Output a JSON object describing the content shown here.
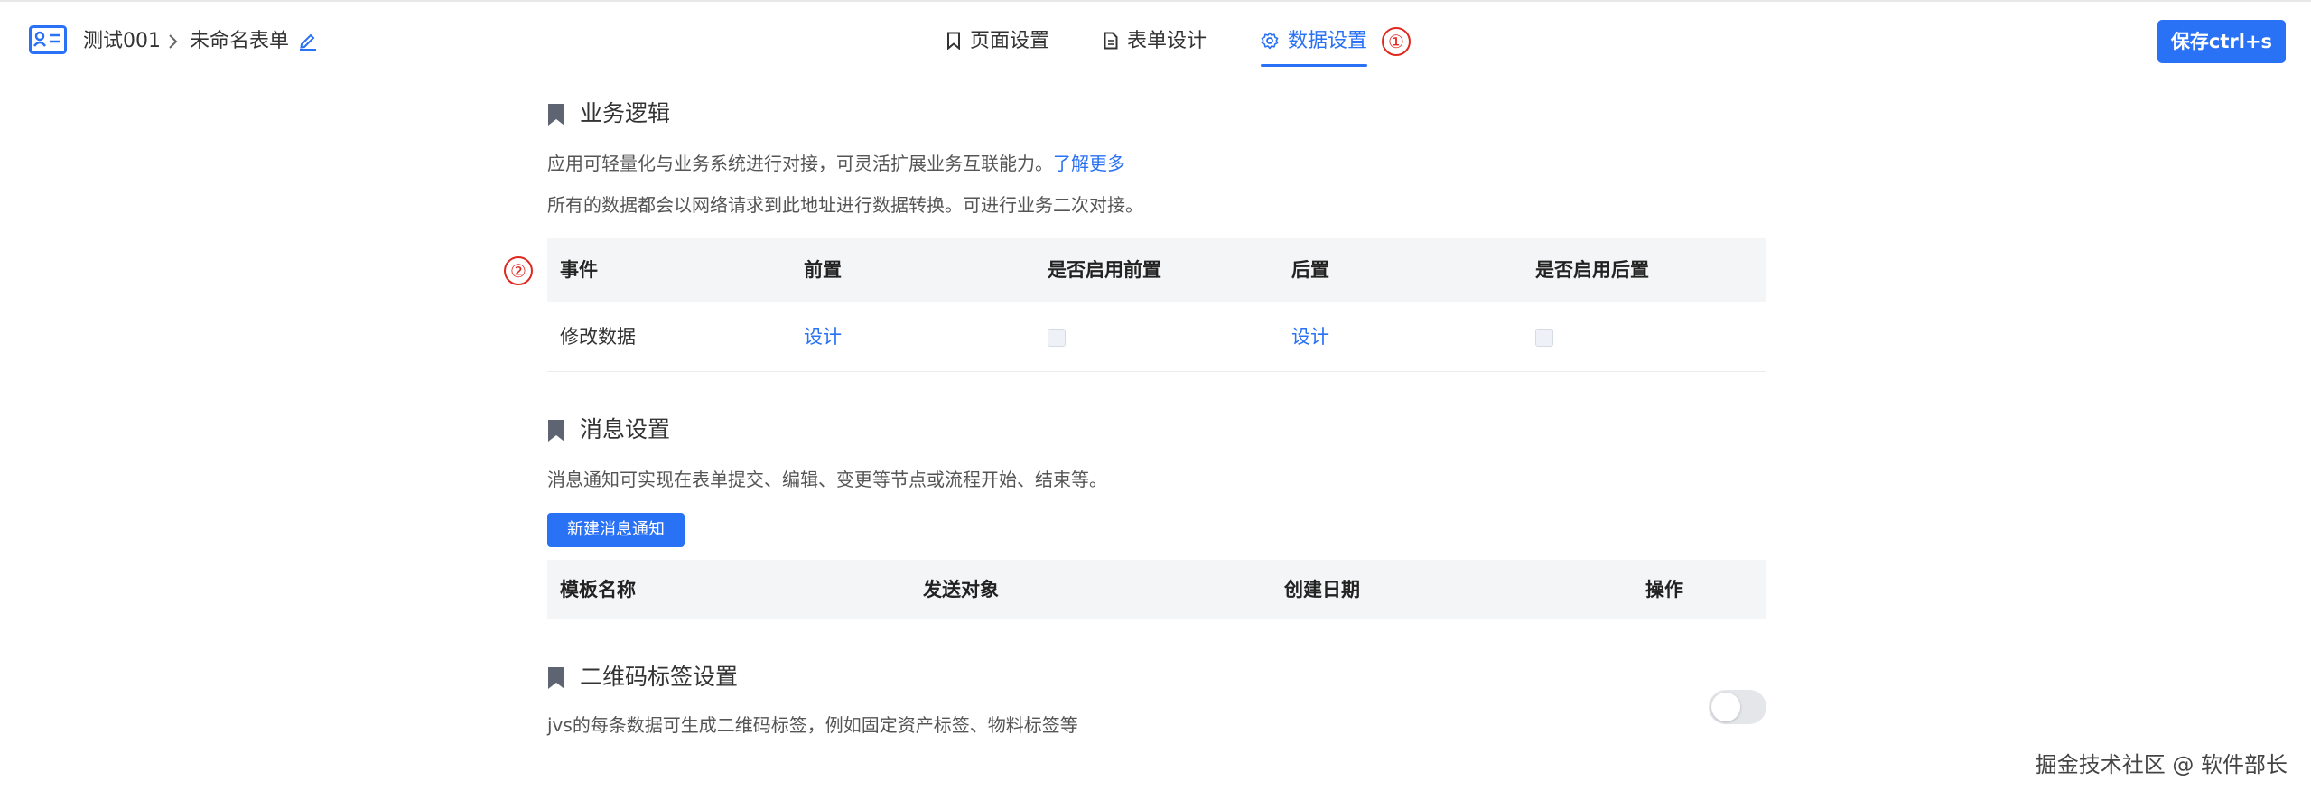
{
  "header": {
    "app_name": "测试001",
    "form_name": "未命名表单",
    "tabs": [
      {
        "label": "页面设置",
        "icon": "bookmark-icon"
      },
      {
        "label": "表单设计",
        "icon": "document-icon"
      },
      {
        "label": "数据设置",
        "icon": "gear-icon",
        "active": true
      }
    ],
    "annotation": "①",
    "save_label": "保存ctrl+s"
  },
  "business_logic": {
    "title": "业务逻辑",
    "desc1": "应用可轻量化与业务系统进行对接，可灵活扩展业务互联能力。",
    "learn_more": "了解更多",
    "desc2": "所有的数据都会以网络请求到此地址进行数据转换。可进行业务二次对接。",
    "annotation": "②",
    "columns": [
      "事件",
      "前置",
      "是否启用前置",
      "后置",
      "是否启用后置"
    ],
    "rows": [
      {
        "event": "修改数据",
        "pre": "设计",
        "pre_enabled": false,
        "post": "设计",
        "post_enabled": false
      }
    ]
  },
  "message": {
    "title": "消息设置",
    "desc": "消息通知可实现在表单提交、编辑、变更等节点或流程开始、结束等。",
    "new_button": "新建消息通知",
    "columns": [
      "模板名称",
      "发送对象",
      "创建日期",
      "操作"
    ]
  },
  "qrcode": {
    "title": "二维码标签设置",
    "desc": "jvs的每条数据可生成二维码标签，例如固定资产标签、物料标签等",
    "enabled": false
  },
  "watermark": "掘金技术社区 @ 软件部长",
  "colors": {
    "accent": "#2971f5",
    "annotation": "#e0281f",
    "table_header_bg": "#f4f5f7"
  }
}
